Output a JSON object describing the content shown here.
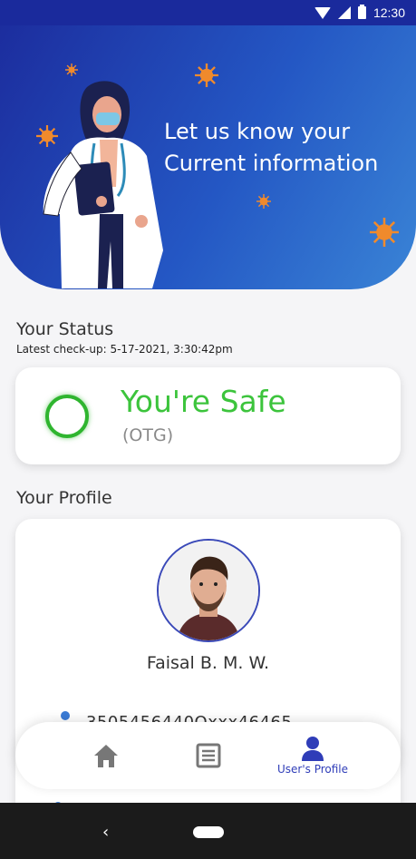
{
  "status_bar": {
    "time": "12:30",
    "icons": [
      "wifi-icon",
      "signal-icon",
      "battery-icon"
    ]
  },
  "header": {
    "title_line1": "Let us know your",
    "title_line2": "Current information",
    "illustration": "doctor-illustration",
    "colors": {
      "gradient_start": "#1c2d9e",
      "gradient_end": "#3a84d6",
      "virus": "#f08a2c"
    }
  },
  "status_section": {
    "title": "Your Status",
    "checkup": "Latest check-up: 5-17-2021, 3:30:42pm",
    "status_text": "You're Safe",
    "status_sub": "(OTG)",
    "status_color": "#3cc43c"
  },
  "profile_section": {
    "title": "Your Profile",
    "name": "Faisal B. M. W.",
    "id_value": "3505456440Qxxx46465"
  },
  "bottom_nav": {
    "items": [
      {
        "icon": "home-icon",
        "label": ""
      },
      {
        "icon": "news-icon",
        "label": ""
      },
      {
        "icon": "user-icon",
        "label": "User's Profile",
        "active": true
      }
    ],
    "active_color": "#2f3db8"
  },
  "system_nav": {
    "back_glyph": "‹"
  }
}
